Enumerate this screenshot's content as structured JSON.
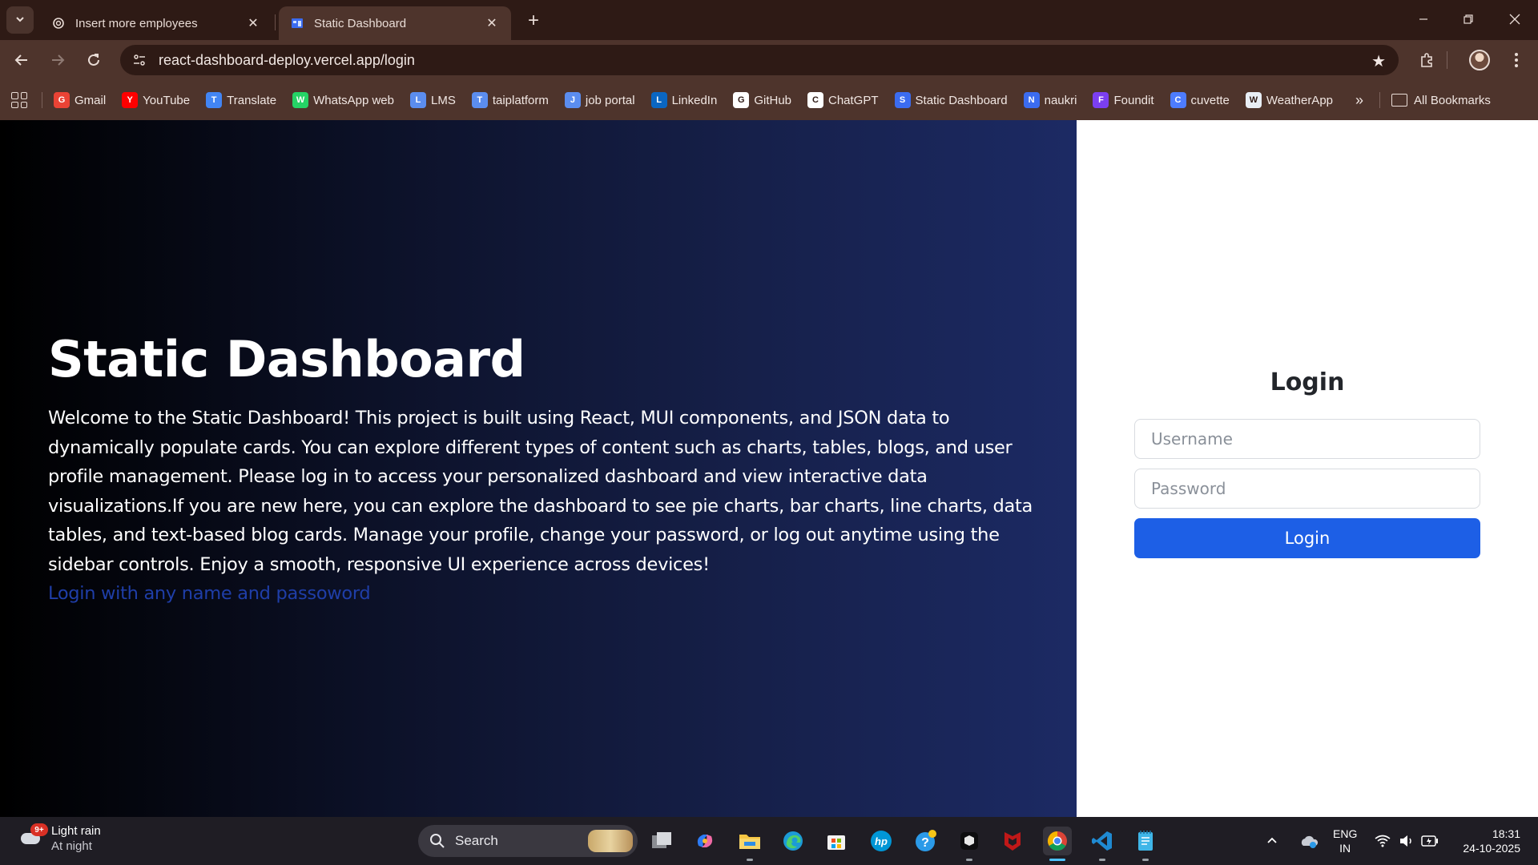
{
  "browser": {
    "tabs": [
      {
        "title": "Insert more employees",
        "active": false
      },
      {
        "title": "Static Dashboard",
        "active": true
      }
    ],
    "url": "react-dashboard-deploy.vercel.app/login",
    "bookmarks": [
      {
        "label": "Gmail",
        "icon": "gmail-icon",
        "color": "#ea4335"
      },
      {
        "label": "YouTube",
        "icon": "youtube-icon",
        "color": "#ff0000"
      },
      {
        "label": "Translate",
        "icon": "translate-icon",
        "color": "#4285f4"
      },
      {
        "label": "WhatsApp web",
        "icon": "whatsapp-icon",
        "color": "#25d366"
      },
      {
        "label": "LMS",
        "icon": "lms-icon",
        "color": "#5b8def"
      },
      {
        "label": "taiplatform",
        "icon": "taiplatform-icon",
        "color": "#5b8def"
      },
      {
        "label": "job portal",
        "icon": "job-portal-icon",
        "color": "#5b8def"
      },
      {
        "label": "LinkedIn",
        "icon": "linkedin-icon",
        "color": "#0a66c2"
      },
      {
        "label": "GitHub",
        "icon": "github-icon",
        "color": "#ffffff"
      },
      {
        "label": "ChatGPT",
        "icon": "chatgpt-icon",
        "color": "#ffffff"
      },
      {
        "label": "Static Dashboard",
        "icon": "dashboard-icon",
        "color": "#3b6cf0"
      },
      {
        "label": "naukri",
        "icon": "naukri-icon",
        "color": "#3b6cf0"
      },
      {
        "label": "Foundit",
        "icon": "foundit-icon",
        "color": "#7b3ff2"
      },
      {
        "label": "cuvette",
        "icon": "cuvette-icon",
        "color": "#4d7cff"
      },
      {
        "label": "WeatherApp",
        "icon": "weather-icon",
        "color": "#e9eef5"
      }
    ],
    "all_bookmarks_label": "All Bookmarks"
  },
  "hero": {
    "title": "Static Dashboard",
    "body": "Welcome to the Static Dashboard! This project is built using React, MUI components, and JSON data to dynamically populate cards. You can explore different types of content such as charts, tables, blogs, and user profile management. Please log in to access your personalized dashboard and view interactive data visualizations.If you are new here, you can explore the dashboard to see pie charts, bar charts, line charts, data tables, and text-based blog cards. Manage your profile, change your password, or log out anytime using the sidebar controls. Enjoy a smooth, responsive UI experience across devices!",
    "hint": "Login with any name and passoword"
  },
  "login": {
    "heading": "Login",
    "username_placeholder": "Username",
    "password_placeholder": "Password",
    "button_label": "Login",
    "button_color": "#1d5fe6"
  },
  "taskbar": {
    "weather": {
      "badge": "9+",
      "condition": "Light rain",
      "period": "At night"
    },
    "search_placeholder": "Search",
    "language": {
      "line1": "ENG",
      "line2": "IN"
    },
    "time": "18:31",
    "date": "24-10-2025"
  }
}
